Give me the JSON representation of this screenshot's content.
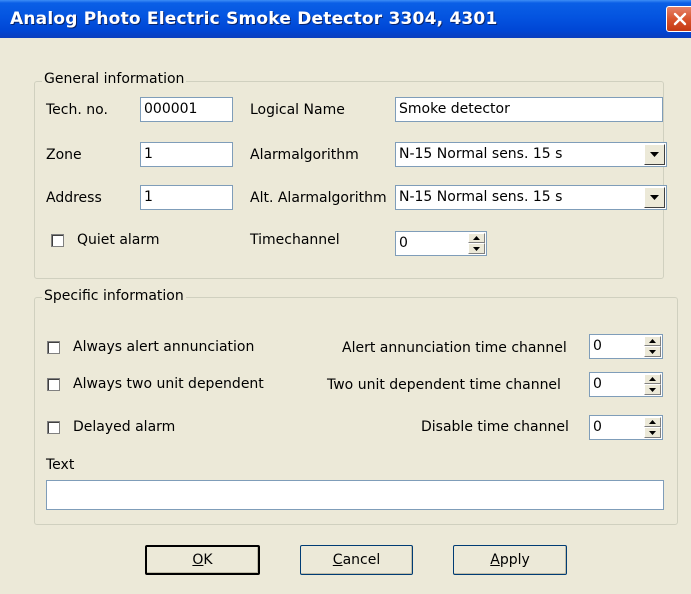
{
  "window": {
    "title": "Analog Photo Electric Smoke Detector 3304, 4301",
    "close_icon": "close-icon"
  },
  "general": {
    "legend": "General information",
    "tech_no_label": "Tech. no.",
    "tech_no_value": "000001",
    "logical_name_label": "Logical Name",
    "logical_name_value": "Smoke detector",
    "zone_label": "Zone",
    "zone_value": "1",
    "alarmalgorithm_label": "Alarmalgorithm",
    "alarmalgorithm_value": "N-15 Normal sens. 15 s",
    "address_label": "Address",
    "address_value": "1",
    "alt_alarmalgorithm_label": "Alt. Alarmalgorithm",
    "alt_alarmalgorithm_value": "N-15 Normal sens. 15 s",
    "quiet_alarm_label": "Quiet alarm",
    "quiet_alarm_checked": false,
    "timechannel_label": "Timechannel",
    "timechannel_value": "0"
  },
  "specific": {
    "legend": "Specific information",
    "always_alert_label": "Always alert annunciation",
    "always_alert_checked": false,
    "always_two_unit_label": "Always two unit dependent",
    "always_two_unit_checked": false,
    "delayed_alarm_label": "Delayed alarm",
    "delayed_alarm_checked": false,
    "alert_tc_label": "Alert annunciation time channel",
    "alert_tc_value": "0",
    "two_unit_tc_label": "Two unit dependent time channel",
    "two_unit_tc_value": "0",
    "disable_tc_label": "Disable time channel",
    "disable_tc_value": "0",
    "text_label": "Text",
    "text_value": ""
  },
  "buttons": {
    "ok_mnemonic": "O",
    "ok_rest": "K",
    "cancel_mnemonic": "C",
    "cancel_rest": "ancel",
    "apply_mnemonic": "A",
    "apply_rest": "pply"
  },
  "colors": {
    "titlebar": "#0454E0",
    "face": "#ECE9D8",
    "close": "#D9542D"
  }
}
